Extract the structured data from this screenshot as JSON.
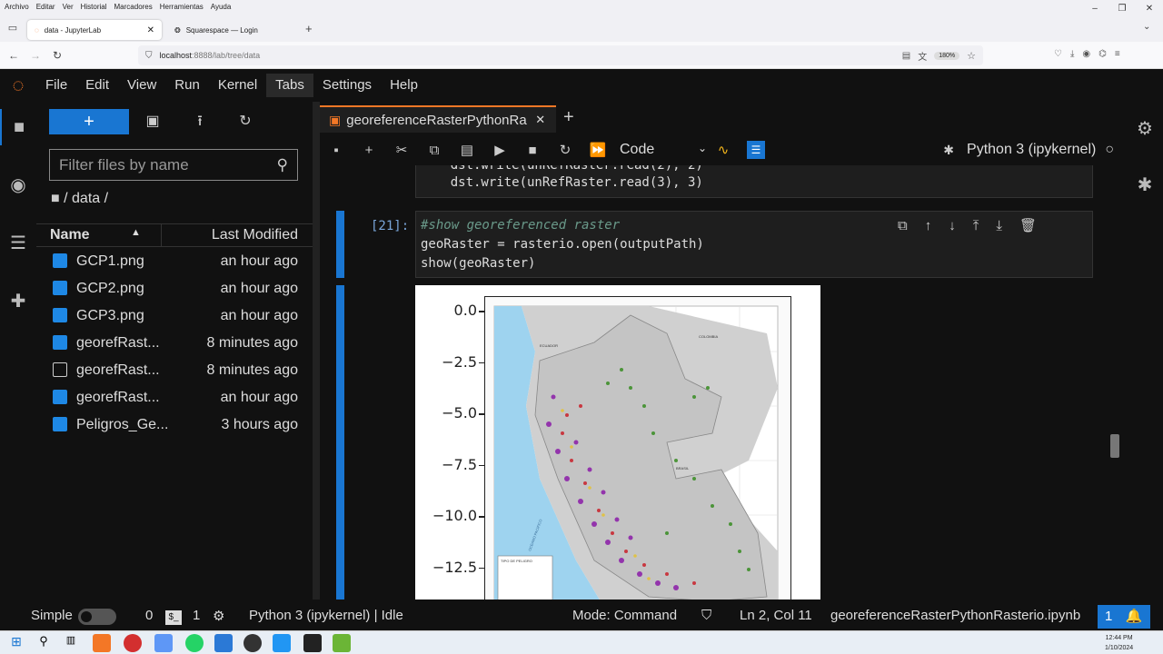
{
  "browser": {
    "menu": [
      "Archivo",
      "Editar",
      "Ver",
      "Historial",
      "Marcadores",
      "Herramientas",
      "Ayuda"
    ],
    "tabs": [
      {
        "title": "data - JupyterLab",
        "active": true
      },
      {
        "title": "Squarespace — Login",
        "active": false
      }
    ],
    "url_host": "localhost",
    "url_path": ":8888/lab/tree/data",
    "zoom": "180%"
  },
  "jupyter": {
    "menu": [
      "File",
      "Edit",
      "View",
      "Run",
      "Kernel",
      "Tabs",
      "Settings",
      "Help"
    ],
    "active_menu": "Tabs",
    "filter_placeholder": "Filter files by name",
    "breadcrumb": "/ data /",
    "columns": {
      "name": "Name",
      "modified": "Last Modified"
    },
    "files": [
      {
        "name": "GCP1.png",
        "modified": "an hour ago",
        "kind": "image"
      },
      {
        "name": "GCP2.png",
        "modified": "an hour ago",
        "kind": "image"
      },
      {
        "name": "GCP3.png",
        "modified": "an hour ago",
        "kind": "image"
      },
      {
        "name": "georefRast...",
        "modified": "8 minutes ago",
        "kind": "image"
      },
      {
        "name": "georefRast...",
        "modified": "8 minutes ago",
        "kind": "file"
      },
      {
        "name": "georefRast...",
        "modified": "an hour ago",
        "kind": "image"
      },
      {
        "name": "Peligros_Ge...",
        "modified": "3 hours ago",
        "kind": "image"
      }
    ],
    "notebook_tab": "georeferenceRasterPythonRa",
    "cell_type": "Code",
    "kernel": "Python 3 (ipykernel)",
    "prev_cell_lines": [
      "    dst.write(unRefRaster.read(2), 2)",
      "    dst.write(unRefRaster.read(3), 3)"
    ],
    "cell_prompt": "[21]:",
    "cell_lines": [
      "#show georeferenced raster",
      "geoRaster = rasterio.open(outputPath)",
      "show(geoRaster)"
    ],
    "plot_yticks": [
      "0.0",
      "−2.5",
      "−5.0",
      "−7.5",
      "−10.0",
      "−12.5"
    ],
    "map_labels": [
      "ECUADOR",
      "COLOMBIA",
      "BRASIL",
      "OCEANO PACIFICO",
      "TIPO DE PELIGRO"
    ]
  },
  "status": {
    "mode_label": "Simple",
    "terminals": "0",
    "kernels": "1",
    "kernel_status": "Python 3 (ipykernel) | Idle",
    "mode": "Mode: Command",
    "position": "Ln 2, Col 11",
    "filename": "georeferenceRasterPythonRasterio.ipynb",
    "notifications": "1"
  },
  "taskbar": {
    "time": "12:44 PM",
    "date": "1/10/2024"
  },
  "colors": {
    "accent": "#1976d2",
    "jupyter_orange": "#f37726",
    "background": "#111111"
  }
}
